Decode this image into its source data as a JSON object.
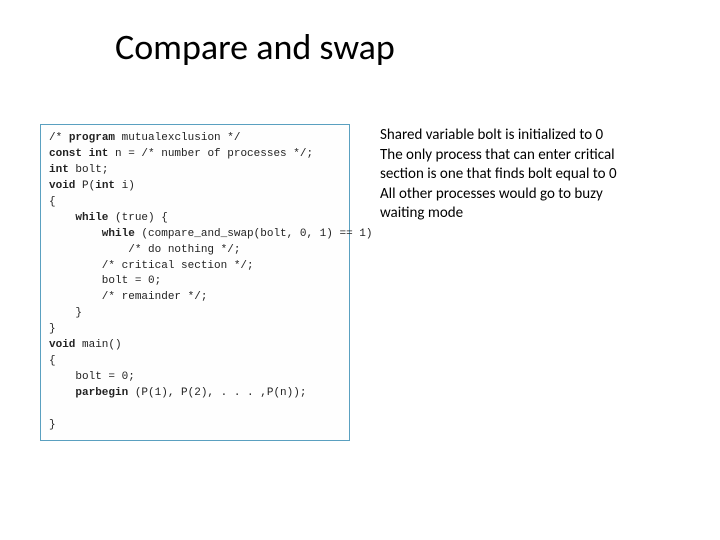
{
  "title": "Compare and swap",
  "code": {
    "l1a": "/* ",
    "l1b": "program",
    "l1c": " mutualexclusion */",
    "l2a": "const int",
    "l2b": " n = /* number of processes */;",
    "l3a": "int",
    "l3b": " bolt;",
    "l4a": "void",
    "l4b": " P(",
    "l4c": "int",
    "l4d": " i)",
    "l5": "{",
    "l6a": "    while",
    "l6b": " (true) {",
    "l7a": "        while",
    "l7b": " (compare_and_swap(bolt, 0, 1) == 1)",
    "l8": "            /* do nothing */;",
    "l9": "        /* critical section */;",
    "l10": "        bolt = 0;",
    "l11": "        /* remainder */;",
    "l12": "    }",
    "l13": "}",
    "l14a": "void",
    "l14b": " main()",
    "l15": "{",
    "l16": "    bolt = 0;",
    "l17a": "    parbegin",
    "l17b": " (P(1), P(2), . . . ,P(n));",
    "l18": "",
    "l19": "}"
  },
  "desc": {
    "p1": "Shared variable bolt is initialized to 0",
    "p2": "The only process that can enter critical section is one that finds bolt equal to 0",
    "p3": "All other processes would go to buzy waiting mode"
  }
}
